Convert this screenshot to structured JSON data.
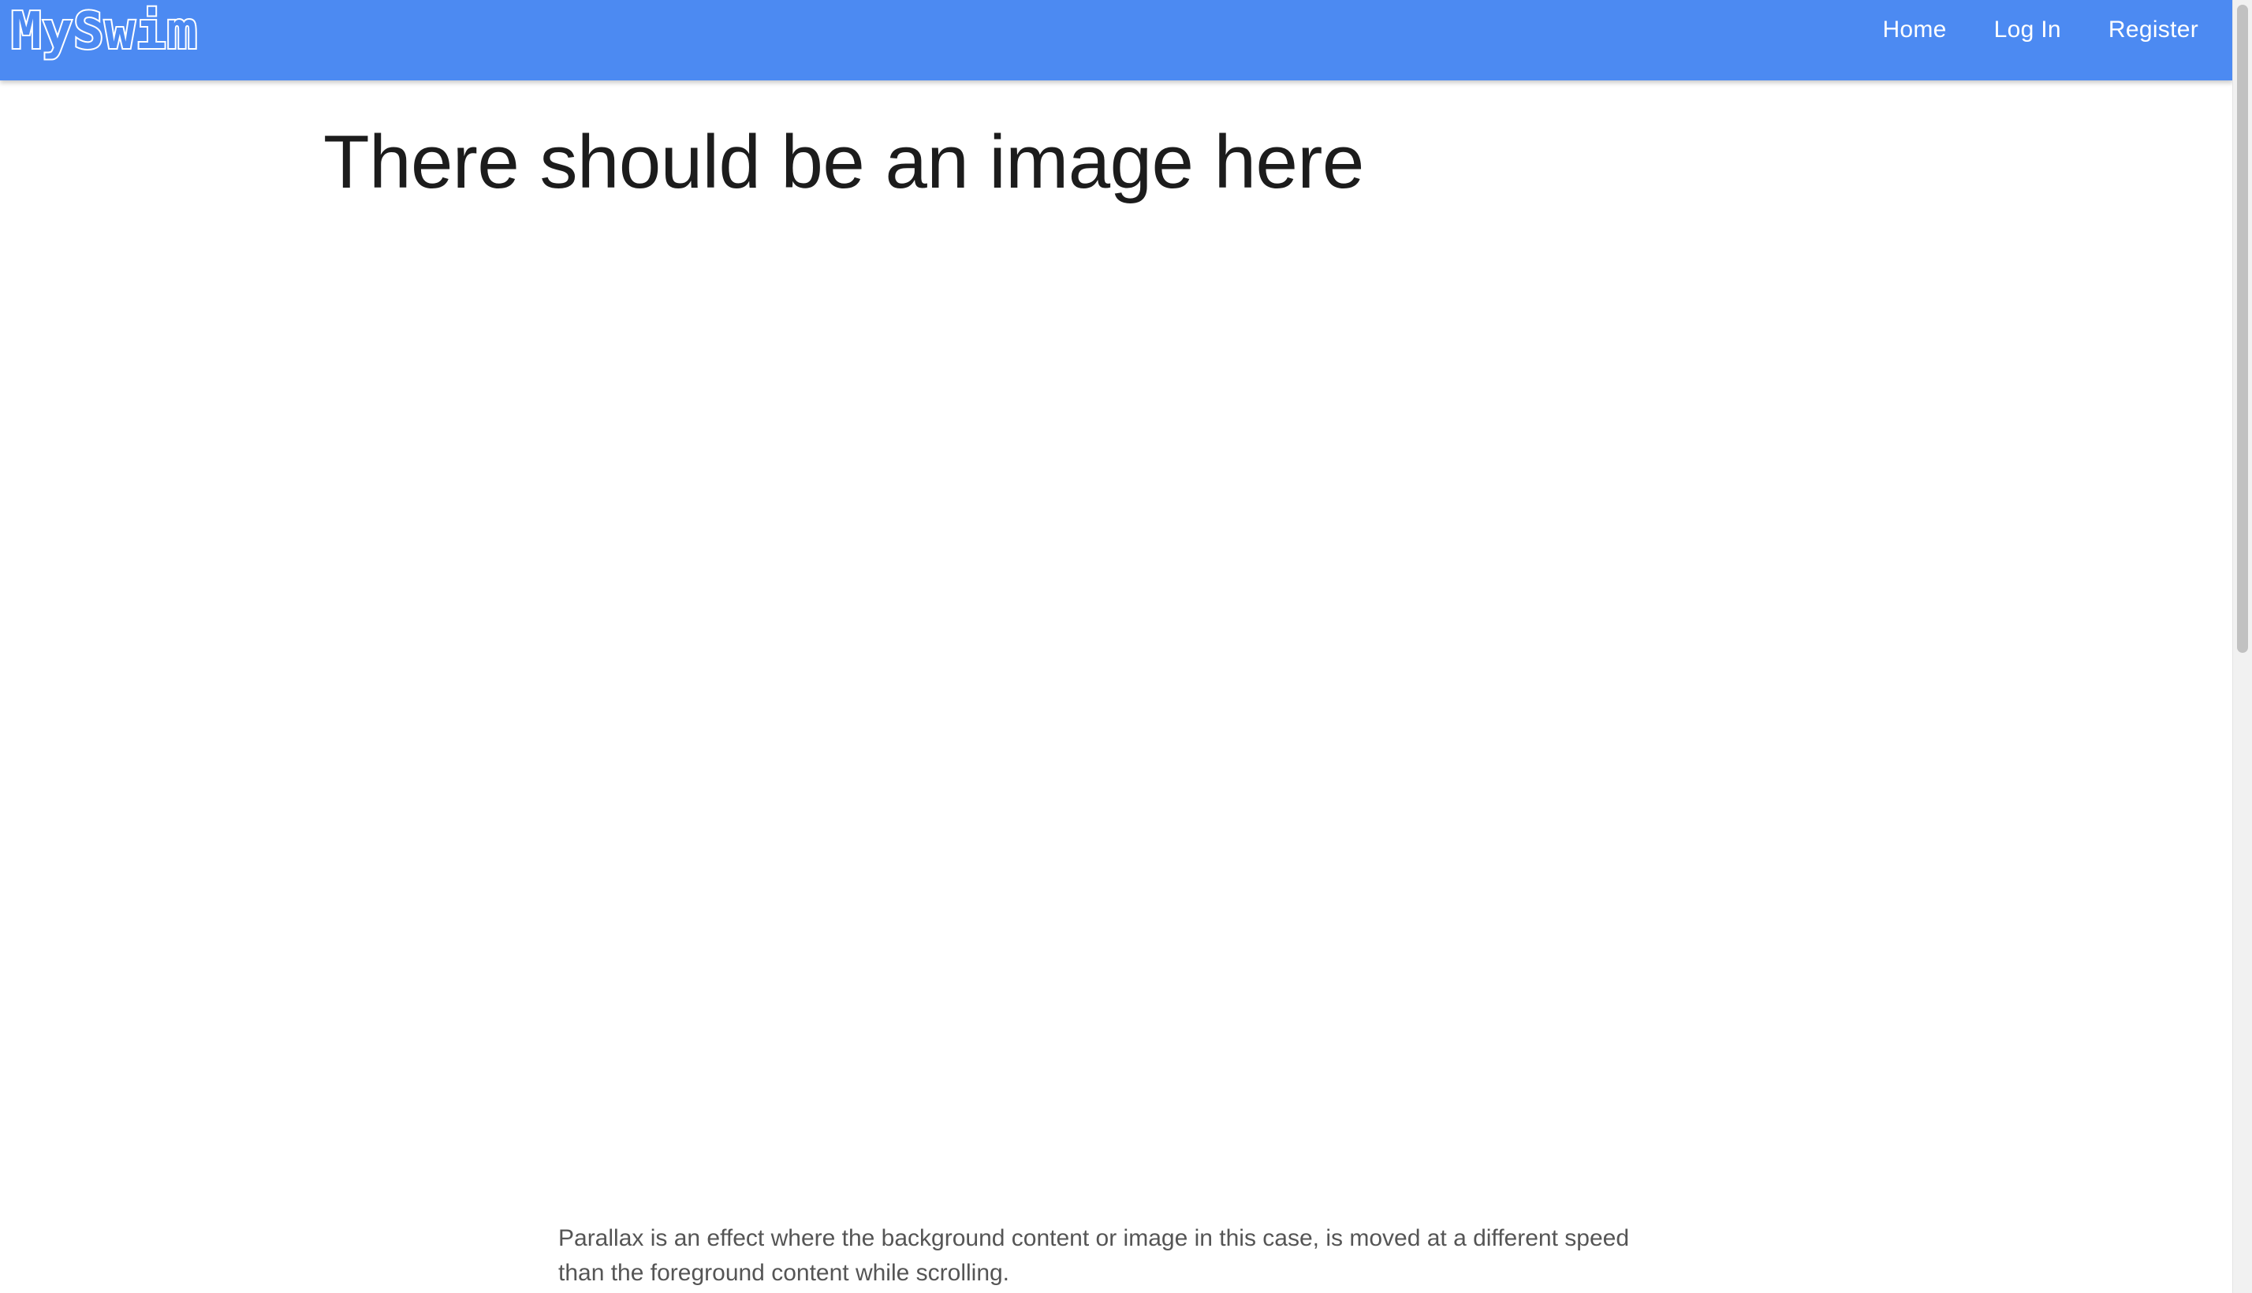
{
  "navbar": {
    "brand": "MySwim",
    "links": [
      {
        "label": "Home"
      },
      {
        "label": "Log In"
      },
      {
        "label": "Register"
      }
    ],
    "background_color": "#4c8af2",
    "text_color": "#ffffff"
  },
  "main": {
    "title": "There should be an image here",
    "description": "Parallax is an effect where the background content or image in this case, is moved at a different speed than the foreground content while scrolling."
  },
  "colors": {
    "page_background": "#ffffff",
    "title_text": "#1c1c1c",
    "body_text": "#555555"
  }
}
